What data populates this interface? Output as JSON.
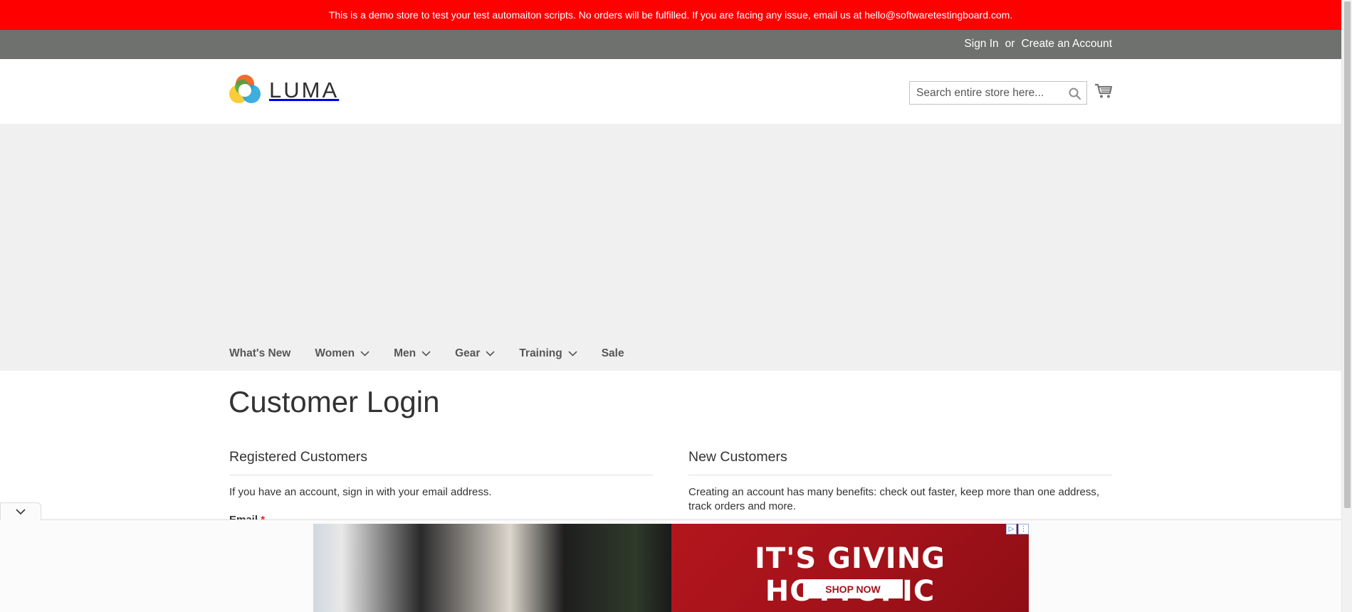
{
  "demo_banner": {
    "text": "This is a demo store to test your test automaiton scripts. No orders will be fulfilled. If you are facing any issue, email us at hello@softwaretestingboard.com."
  },
  "panel": {
    "sign_in": "Sign In",
    "or": "or",
    "create_account": "Create an Account"
  },
  "header": {
    "logo_text": "LUMA",
    "search_placeholder": "Search entire store here...",
    "search_icon": "search-icon",
    "cart_icon": "cart-icon"
  },
  "nav": {
    "items": [
      {
        "label": "What's New",
        "has_dropdown": false
      },
      {
        "label": "Women",
        "has_dropdown": true
      },
      {
        "label": "Men",
        "has_dropdown": true
      },
      {
        "label": "Gear",
        "has_dropdown": true
      },
      {
        "label": "Training",
        "has_dropdown": true
      },
      {
        "label": "Sale",
        "has_dropdown": false
      }
    ]
  },
  "main": {
    "page_title": "Customer Login",
    "registered": {
      "title": "Registered Customers",
      "description": "If you have an account, sign in with your email address.",
      "email_label": "Email",
      "required_mark": "*"
    },
    "new_customers": {
      "title": "New Customers",
      "description": "Creating an account has many benefits: check out faster, keep more than one address, track orders and more."
    }
  },
  "ad": {
    "headline": "IT'S GIVING HOTTOPIC",
    "cta": "SHOP NOW",
    "toggle_icon": "chevron-down-icon"
  },
  "colors": {
    "banner_red": "#ff0000",
    "panel_gray": "#6e716e",
    "nav_band": "#f0f0f0",
    "required_red": "#e02b27",
    "ad_red": "#a4121a"
  }
}
